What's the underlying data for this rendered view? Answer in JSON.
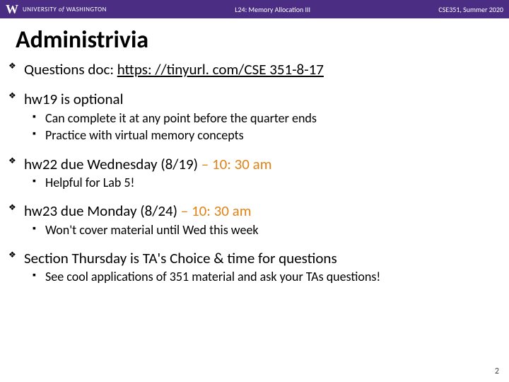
{
  "header": {
    "university_prefix": "UNIVERSITY",
    "university_of": "of",
    "university_name": "WASHINGTON",
    "lecture_label": "L24: Memory Allocation III",
    "course_label": "CSE351, Summer 2020"
  },
  "title": "Administrivia",
  "bullets": {
    "b1_prefix": "Questions doc: ",
    "b1_link": "https: //tinyurl. com/CSE 351-8-17",
    "b2": "hw19 is optional",
    "b2_s1": "Can complete it at any point before the quarter ends",
    "b2_s2": "Practice with virtual memory concepts",
    "b3_a": "hw22 due Wednesday (8/19) ",
    "b3_b": "– 10: 30 am",
    "b3_s1": "Helpful for Lab 5!",
    "b4_a": "hw23 due Monday (8/24) ",
    "b4_b": "– 10: 30 am",
    "b4_s1": "Won't cover material until Wed this week",
    "b5": "Section Thursday is TA's Choice & time for questions",
    "b5_s1": "See cool applications of 351 material and ask your TAs questions!"
  },
  "page_number": "2"
}
